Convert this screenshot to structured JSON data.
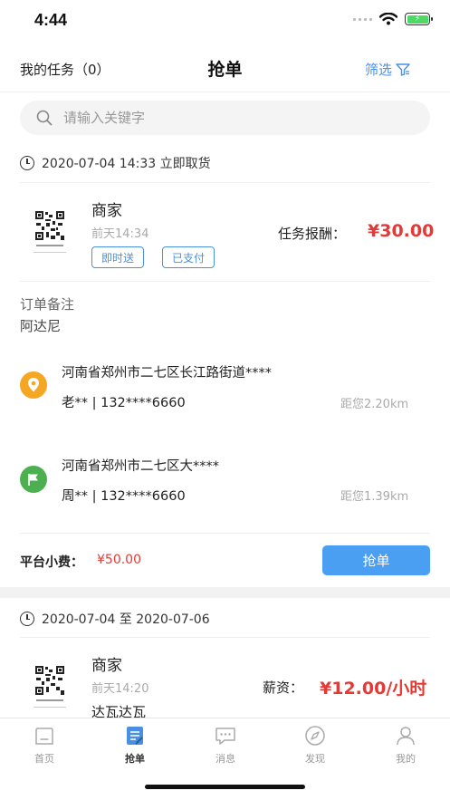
{
  "status_bar": {
    "time": "4:44"
  },
  "nav": {
    "my_tasks": "我的任务（0）",
    "title": "抢单",
    "filter": "筛选"
  },
  "search": {
    "placeholder": "请输入关键字"
  },
  "orders": [
    {
      "header": "2020-07-04 14:33  立即取货",
      "merchant": "商家",
      "time": "前天14:34",
      "tags": [
        "即时送",
        "已支付"
      ],
      "reward_label": "任务报酬：",
      "reward": "¥30.00",
      "remark_title": "订单备注",
      "remark": "阿达尼",
      "pickup": {
        "address": "河南省郑州市二七区长江路街道****",
        "contact": "老** | 132****6660",
        "distance": "距您2.20km"
      },
      "dropoff": {
        "address": "河南省郑州市二七区大****",
        "contact": "周** | 132****6660",
        "distance": "距您1.39km"
      },
      "fee_label": "平台小费：",
      "fee": "¥50.00",
      "button": "抢单"
    },
    {
      "header": "2020-07-04 至 2020-07-06",
      "merchant": "商家",
      "time": "前天14:20",
      "salary_label": "薪资：",
      "salary": "¥12.00/小时",
      "note": "达瓦达瓦"
    }
  ],
  "tabbar": {
    "items": [
      {
        "label": "首页",
        "icon": "home-icon"
      },
      {
        "label": "抢单",
        "icon": "grab-order-icon"
      },
      {
        "label": "消息",
        "icon": "message-icon"
      },
      {
        "label": "发现",
        "icon": "compass-icon"
      },
      {
        "label": "我的",
        "icon": "user-icon"
      }
    ],
    "active_color": "#333333",
    "inactive_color": "#999999"
  },
  "colors": {
    "accent": "#4a90e2",
    "price": "#e53935",
    "pickup_icon": "#f5a623",
    "dropoff_icon": "#4caf50"
  }
}
